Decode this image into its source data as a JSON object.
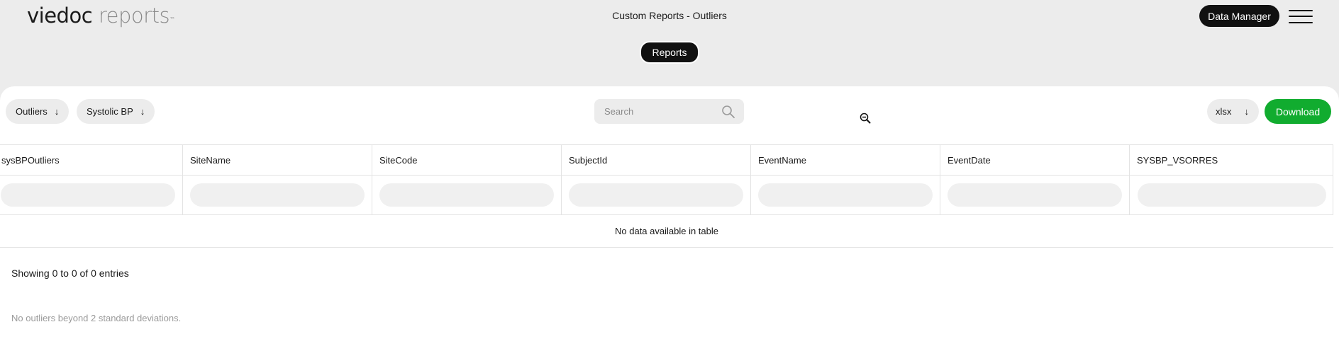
{
  "header": {
    "logo_primary": "viedoc",
    "logo_secondary": "reports",
    "logo_tm": "™",
    "title": "Custom Reports - Outliers",
    "data_manager_label": "Data Manager",
    "reports_label": "Reports"
  },
  "toolbar": {
    "filter1_label": "Outliers",
    "filter2_label": "Systolic BP",
    "search_placeholder": "Search",
    "format_label": "xlsx",
    "download_label": "Download",
    "arrow": "↓",
    "accent_color": "#11ac2f"
  },
  "table": {
    "columns": [
      "sysBPOutliers",
      "SiteName",
      "SiteCode",
      "SubjectId",
      "EventName",
      "EventDate",
      "SYSBP_VSORRES"
    ],
    "empty_message": "No data available in table"
  },
  "footer": {
    "info": "Showing 0 to 0 of 0 entries",
    "note": "No outliers beyond 2 standard deviations."
  }
}
